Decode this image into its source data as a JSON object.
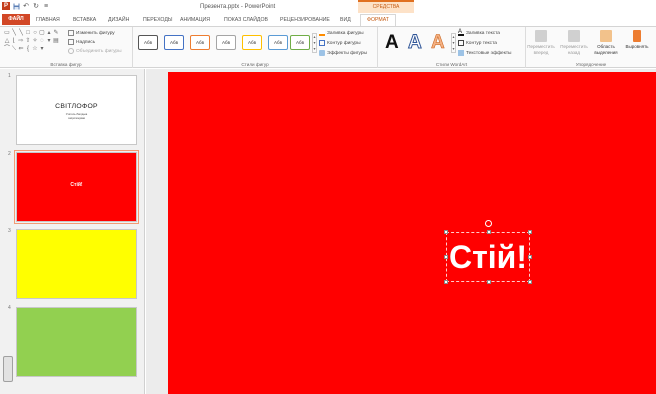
{
  "window": {
    "title": "Презента.pptx - PowerPoint",
    "context_group": "СРЕДСТВА РИСОВАНИЯ"
  },
  "qat": {
    "app_icon": "P",
    "save_icon": "save-icon",
    "undo_icon": "↶",
    "redo_icon": "↻",
    "customize_icon": "≡"
  },
  "tabs": [
    {
      "label": "ФАЙЛ"
    },
    {
      "label": "ГЛАВНАЯ"
    },
    {
      "label": "ВСТАВКА"
    },
    {
      "label": "ДИЗАЙН"
    },
    {
      "label": "ПЕРЕХОДЫ"
    },
    {
      "label": "АНИМАЦИЯ"
    },
    {
      "label": "ПОКАЗ СЛАЙДОВ"
    },
    {
      "label": "РЕЦЕНЗИРОВАНИЕ"
    },
    {
      "label": "ВИД"
    },
    {
      "label": "ФОРМАТ"
    }
  ],
  "ribbon": {
    "insert_shapes": {
      "label": "Вставка фигур",
      "change_shape": "Изменить фигуру",
      "text_box": "Надпись",
      "merge_shapes": "Объединить фигуры"
    },
    "shape_styles": {
      "label": "Стили фигур",
      "style_sample": "Абв",
      "fill": "Заливка фигуры",
      "outline": "Контур фигуры",
      "effects": "Эффекты фигуры"
    },
    "wordart": {
      "label": "Стили WordArt",
      "letter": "A",
      "text_fill": "Заливка текста",
      "text_outline": "Контур текста",
      "text_effects": "Текстовые эффекты"
    },
    "arrange": {
      "label": "Упорядочение",
      "bring_forward": "Переместить вперед",
      "send_backward": "Переместить назад",
      "selection_pane": "Область выделения",
      "align": "Выровнять"
    }
  },
  "slides": [
    {
      "number": "1",
      "title": "СВІТЛОФОР",
      "subtitle": "Учитель Лагодька\nзапропонував"
    },
    {
      "number": "2",
      "text": "Стій!"
    },
    {
      "number": "3"
    },
    {
      "number": "4"
    }
  ],
  "current_slide": {
    "text": "Стій!"
  },
  "colors": {
    "red": "#ff0000",
    "yellow": "#ffff00",
    "green": "#92d050",
    "file_tab": "#d24726",
    "accent": "#c55a11"
  }
}
